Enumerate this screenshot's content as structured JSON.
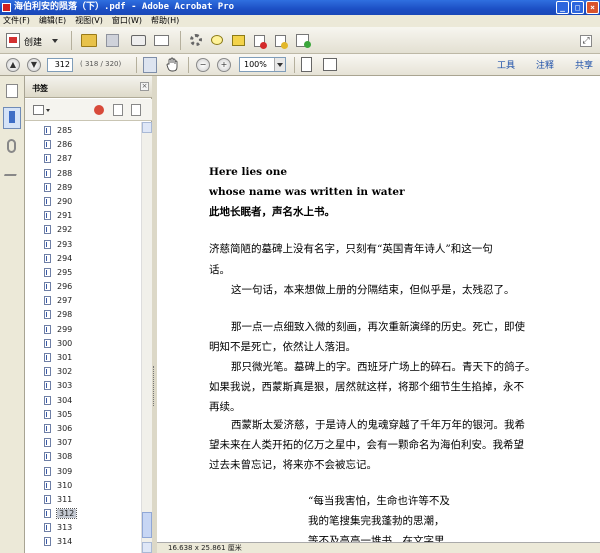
{
  "window": {
    "title": "海伯利安的陨落（下）.pdf - Adobe Acrobat Pro",
    "buttons": {
      "minimize": "_",
      "maximize": "□",
      "close": "×"
    }
  },
  "menu": [
    "文件(F)",
    "编辑(E)",
    "视图(V)",
    "窗口(W)",
    "帮助(H)"
  ],
  "toolbar": {
    "create_label": "创建",
    "page_current": "312",
    "page_count": "( 318 / 320)",
    "zoom": "100%",
    "tools_label": "工具",
    "comment_label": "注释",
    "share_label": "共享"
  },
  "bookmarks": {
    "title": "书签",
    "close": "×",
    "items": [
      "285",
      "286",
      "287",
      "288",
      "289",
      "290",
      "291",
      "292",
      "293",
      "294",
      "295",
      "296",
      "297",
      "298",
      "299",
      "300",
      "301",
      "302",
      "303",
      "304",
      "305",
      "306",
      "307",
      "308",
      "309",
      "310",
      "311",
      "312",
      "313",
      "314"
    ],
    "selected": "312"
  },
  "document": {
    "lines": [
      "Here lies one",
      "whose name was written in water",
      "此地长眠者，声名水上书。",
      "济慈简陋的墓碑上没有名字，只刻有“英国青年诗人”和这一句",
      "话。",
      "这一句话，本来想做上册的分隔结束，但似乎是，太残忍了。",
      "那一点一点细致入微的刻画，再次重新演绎的历史。死亡，即使",
      "明知不是死亡，依然让人落泪。",
      "那只微光笔。墓碑上的字。西班牙广场上的碎石。青天下的鸽子。",
      "如果我说，西蒙斯真是狠，居然就这样，将那个细节生生掐掉，永不",
      "再续。",
      "西蒙斯太爱济慈，于是诗人的鬼魂穿越了千年万年的银河。我希",
      "望未来在人类开拓的亿万之星中，会有一颗命名为海伯利安。我希望",
      "过去未曾忘记，将来亦不会被忘记。",
      "“每当我害怕，生命也许等不及",
      "我的笔搜集完我蓬勃的思潮，",
      "等不及高高一堆书，在文字里，"
    ],
    "page_size": "16.638 x 25.861 厘米"
  }
}
